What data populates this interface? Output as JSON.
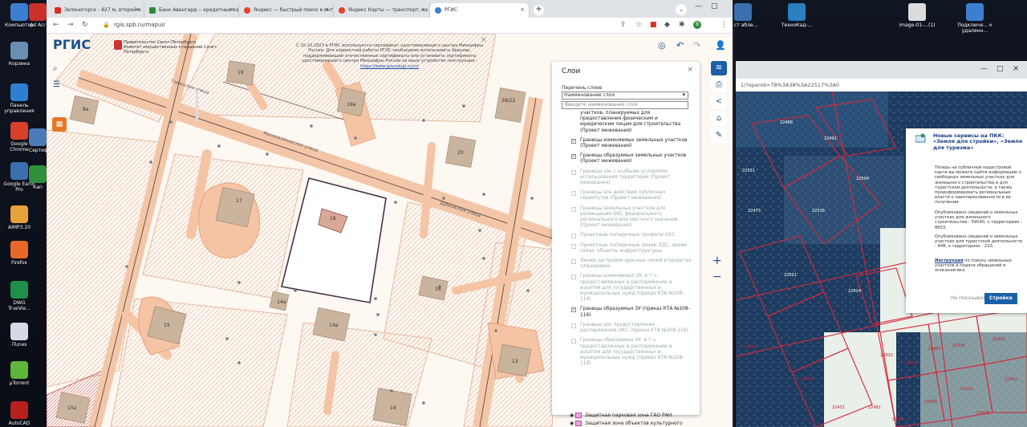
{
  "desktop_icons": [
    {
      "label": "Компьютер",
      "glyph": "computer-icon",
      "color": "#3b7fd0"
    },
    {
      "label": "Корзина",
      "glyph": "recycle-bin-icon",
      "color": "#6b8fb3"
    },
    {
      "label": "Панель управления",
      "glyph": "control-panel-icon",
      "color": "#2f7fd0"
    },
    {
      "label": "Google Chrome",
      "glyph": "chrome-icon",
      "color": "#d9402b"
    },
    {
      "label": "Google Earth Pro",
      "glyph": "google-earth-icon",
      "color": "#3a6fb0"
    },
    {
      "label": "AIMP3.20",
      "glyph": "aimp-icon",
      "color": "#e8a23a"
    },
    {
      "label": "Firefox",
      "glyph": "firefox-icon",
      "color": "#e8682a"
    },
    {
      "label": "DWG TrueVie...",
      "glyph": "dwg-icon",
      "color": "#1f8f4a"
    },
    {
      "label": "iTunes",
      "glyph": "itunes-icon",
      "color": "#d8d8e8"
    },
    {
      "label": "µTorrent",
      "glyph": "utorrent-icon",
      "color": "#5fb53a"
    },
    {
      "label": "AutoCAD",
      "glyph": "autocad-icon",
      "color": "#b8201f"
    }
  ],
  "desktop_icons_col2": [
    {
      "label": "Ad Acr",
      "color": "#c9302c"
    },
    {
      "label": "Сертиф",
      "color": "#4a7ab8"
    },
    {
      "label": "Кап",
      "color": "#2f8f3a"
    }
  ],
  "top_right_icons": [
    {
      "label": "Гаст абле...",
      "color": "#3a6fb0"
    },
    {
      "label": "ТехноКад-...",
      "color": "#2a7fbf"
    },
    {
      "label": "image-01-...(1)",
      "color": "#dcdcdc"
    },
    {
      "label": "Подключе... к удаленн...",
      "color": "#3b7fd0"
    }
  ],
  "browser": {
    "tabs": [
      {
        "label": "Зеленогорск - 827 м, вторей е",
        "color": "#d93025"
      },
      {
        "label": "Банк Авангард -- кредитные ка",
        "color": "#2e8b3a"
      },
      {
        "label": "Яндекс — быстрый поиск в инт",
        "color": "#e8412b"
      },
      {
        "label": "Яндекс Карты — транспорт, на",
        "color": "#e8412b"
      },
      {
        "label": "РГИС",
        "color": "#3b7fd0"
      }
    ],
    "new_tab": "+",
    "url": "rgis.spb.ru/mapui/"
  },
  "map": {
    "logo": "РГИС",
    "gov_title": "Правительство Санкт-Петербурга",
    "gov_subtitle": "Комитет имущественных отношений Санкт-Петербурга",
    "notice": "С 10.10.2023 в РГИС используется сертификат удостоверяющего центра Минцифры России. Для корректной работы РГИС необходимо использовать браузер, поддерживающий отечественные сертификаты или установить сертификаты удостоверяющего центра Минцифры России на ваше устройство (инструкция -",
    "notice_link": "https://www.gosuslugi.ru/crt",
    "notice_close": "×",
    "street1": "Гаванская улица",
    "street2": "Малокалиновская улица",
    "street3": "Дубковская улица",
    "buildings": [
      "19",
      "19а",
      "28/22",
      "8а",
      "20",
      "17",
      "18",
      "14а",
      "16",
      "15",
      "14а",
      "13",
      "14",
      "15а"
    ]
  },
  "layers_panel": {
    "title": "Слои",
    "close": "×",
    "sublabel": "Перечень слоев",
    "select_value": "Наименование слоя",
    "search_placeholder": "Введите наименование слоя",
    "items": [
      {
        "label": "участков, планируемых для предоставления физическим и юридическим лицам для строительства (Проект межевания)",
        "checked": false,
        "off": false,
        "nobox": true
      },
      {
        "label": "Границы изменяемых земельных участков (Проект межевания)",
        "checked": true,
        "off": false
      },
      {
        "label": "Границы образуемых земельных участков (Проект межевания)",
        "checked": true,
        "off": false
      },
      {
        "label": "Границы зон с особыми условиями использования территорий (Проект межевания)",
        "checked": false,
        "off": true
      },
      {
        "label": "Границы зон действия публичных сервитутов (Проект межевания)",
        "checked": false,
        "off": true
      },
      {
        "label": "Границы земельных участков для размещения ОКС федерального, регионального или местного значения (Проект межевания)",
        "checked": false,
        "off": true
      },
      {
        "label": "Проектные поперечные профили ОКС",
        "checked": false,
        "off": true
      },
      {
        "label": "Проектные поперечные линии ЛДС, линии связи, объекты инфраструктуры",
        "checked": false,
        "off": true
      },
      {
        "label": "Линии застройки красных линий в проектах планировки",
        "checked": false,
        "off": true
      },
      {
        "label": "Границы изменяемых ЗУ, в т.ч. предоставленных в распоряжение и изъятия для государственных и муниципальных нужд (приказ КТА №208-116)",
        "checked": false,
        "off": true
      },
      {
        "label": "Границы образуемых ЗУ (приказ КТА №208-116)",
        "checked": true,
        "off": false
      },
      {
        "label": "Границы зон предоставления распоряжения ОКС (приказ КТА №208-116)",
        "checked": false,
        "off": true
      },
      {
        "label": "Границы образуемых ЗУ, в т.ч. предоставленных в распоряжение и изъятия для государственных и муниципальных нужд (приказ КТА №208-116)",
        "checked": false,
        "off": true
      }
    ],
    "legend": [
      {
        "label": "Защитная парковая зона ГАО РАН"
      },
      {
        "label": "Защитная зона объектов культурного"
      }
    ]
  },
  "browser2": {
    "url": "1/?openid=78%3A38%3A22517%3A0",
    "card": {
      "heading": "Новые сервисы на ПКК: «Земля для стройки», «Земля для туризма»",
      "p1": "Теперь на публичной кадастровой карте вы можете найти информацию о свободных земельных участках для жилищного строительства и для туристской деятельности, а также проинформировать региональные власти о заинтересованности в их получении.",
      "p2": "Опубликовано сведений о земельных участках для жилищного строительства - 59540, о территориях - 8653.",
      "p3": "Опубликовано сведений о земельных участках для туристской деятельности - 448, о территориях - 210.",
      "p4_link": "Инструкция",
      "p4": "по поиску земельных участков и подаче обращений в описании вкл.",
      "btn_secondary": "Не показывать",
      "btn_primary": "Стройка"
    },
    "parcels": [
      "22531",
      "22501",
      "22473",
      "22492",
      "22433",
      "22431",
      "22424",
      "22468",
      "22491",
      "22504",
      "22516",
      "22415",
      "22469",
      "22481",
      "22458",
      "22561",
      "22441",
      "22534",
      "22522",
      "22508",
      "22413",
      "22442",
      "22483"
    ]
  }
}
